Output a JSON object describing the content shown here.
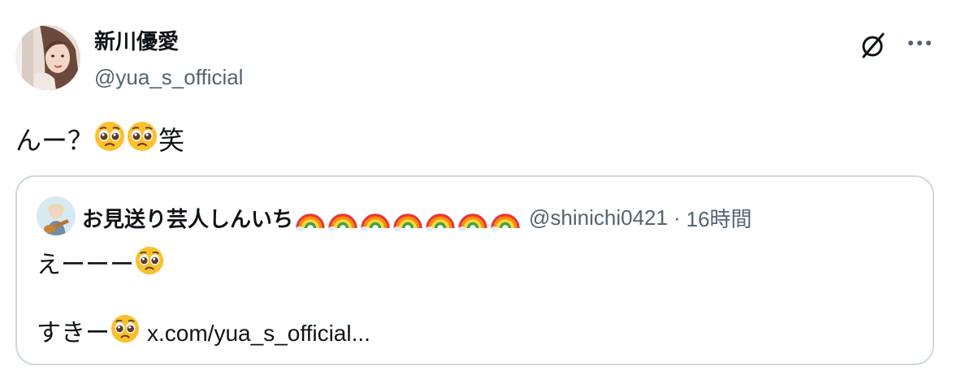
{
  "author": {
    "display_name": "新川優愛",
    "handle": "@yua_s_official"
  },
  "icons": {
    "grok": "grok-icon",
    "more": "more-icon",
    "pleading_face": "pleading-face-emoji",
    "rainbow": "rainbow-emoji"
  },
  "tweet": {
    "text_prefix": "んー？",
    "text_suffix": "笑"
  },
  "quote": {
    "display_name": "お見送り芸人しんいち",
    "rainbow_count": 7,
    "handle": "@shinichi0421",
    "separator": "·",
    "time": "16時間",
    "line1_text": "えーーー",
    "line2_text": "すきー",
    "link_text": "x.com/yua_s_official..."
  },
  "colors": {
    "text_primary": "#0f1419",
    "text_secondary": "#536471",
    "card_border": "#cfd9de"
  }
}
